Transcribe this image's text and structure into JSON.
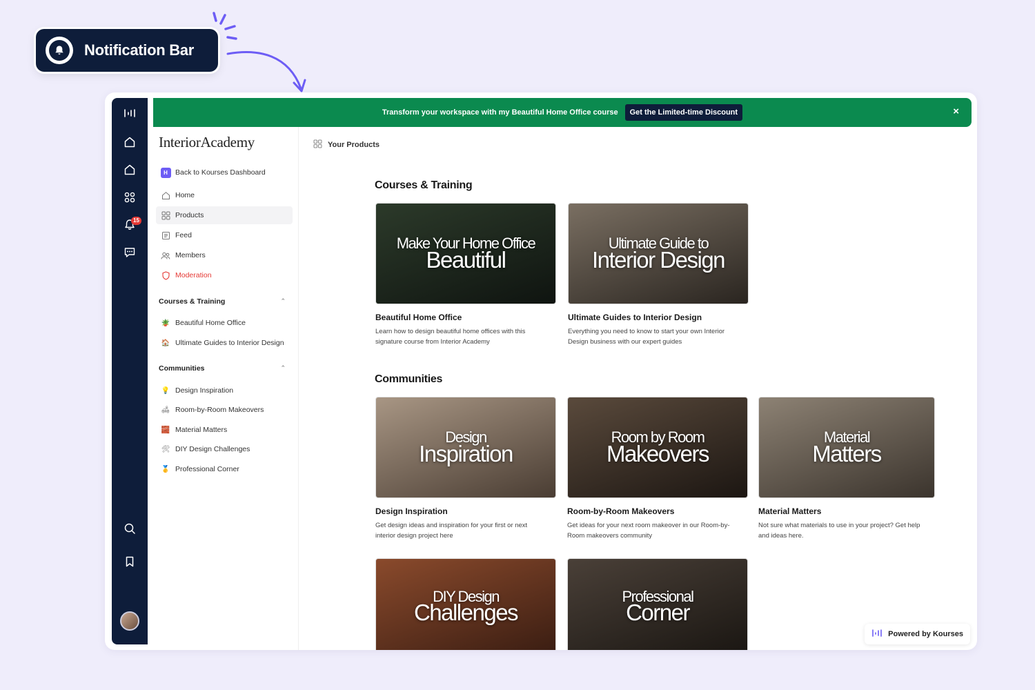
{
  "callout": {
    "label": "Notification Bar"
  },
  "notification": {
    "text": "Transform your workspace with my Beautiful Home Office course",
    "cta": "Get the Limited-time Discount",
    "close": "×"
  },
  "rail": {
    "notification_count": "15"
  },
  "sidebar": {
    "brand": "InteriorAcademy",
    "back": "Back to Kourses Dashboard",
    "nav": [
      {
        "label": "Home"
      },
      {
        "label": "Products"
      },
      {
        "label": "Feed"
      },
      {
        "label": "Members"
      },
      {
        "label": "Moderation"
      }
    ],
    "courses_heading": "Courses & Training",
    "courses": [
      {
        "label": "Beautiful Home Office",
        "emoji": "🪴"
      },
      {
        "label": "Ultimate Guides to Interior Design",
        "emoji": "🏠"
      }
    ],
    "communities_heading": "Communities",
    "communities": [
      {
        "label": "Design Inspiration",
        "emoji": "💡"
      },
      {
        "label": "Room-by-Room Makeovers",
        "emoji": "🛋"
      },
      {
        "label": "Material Matters",
        "emoji": "🧱"
      },
      {
        "label": "DIY Design Challenges",
        "emoji": "🛠"
      },
      {
        "label": "Professional Corner",
        "emoji": "🥇"
      }
    ]
  },
  "main": {
    "breadcrumb": "Your Products",
    "courses_title": "Courses & Training",
    "courses": [
      {
        "img_line1": "Make Your Home Office",
        "img_line2": "Beautiful",
        "title": "Beautiful Home Office",
        "desc": "Learn how to design beautiful home offices with this signature course from Interior Academy",
        "c1": "#2c3a2a",
        "c2": "#0f1410"
      },
      {
        "img_line1": "Ultimate Guide to",
        "img_line2": "Interior Design",
        "title": "Ultimate Guides to Interior Design",
        "desc": "Everything you need to know to start your own Interior Design business with our expert guides",
        "c1": "#7a6f62",
        "c2": "#2a2520"
      }
    ],
    "communities_title": "Communities",
    "communities": [
      {
        "img_line1": "Design",
        "img_line2": "Inspiration",
        "title": "Design Inspiration",
        "desc": "Get design ideas and inspiration for your first or next interior design project here",
        "c1": "#a89684",
        "c2": "#4a3d33"
      },
      {
        "img_line1": "Room by Room",
        "img_line2": "Makeovers",
        "title": "Room-by-Room Makeovers",
        "desc": "Get ideas for your next room makeover in our Room-by-Room makeovers community",
        "c1": "#5a4a3c",
        "c2": "#1c1612"
      },
      {
        "img_line1": "Material",
        "img_line2": "Matters",
        "title": "Material Matters",
        "desc": "Not sure what materials to use in your project? Get help and ideas here.",
        "c1": "#8d8274",
        "c2": "#3b342d"
      },
      {
        "img_line1": "DIY Design",
        "img_line2": "Challenges",
        "title": "",
        "desc": "",
        "c1": "#8a4a2c",
        "c2": "#3a1d12"
      },
      {
        "img_line1": "Professional",
        "img_line2": "Corner",
        "title": "",
        "desc": "",
        "c1": "#4a4038",
        "c2": "#1a1612"
      }
    ]
  },
  "powered_by": "Powered by Kourses"
}
